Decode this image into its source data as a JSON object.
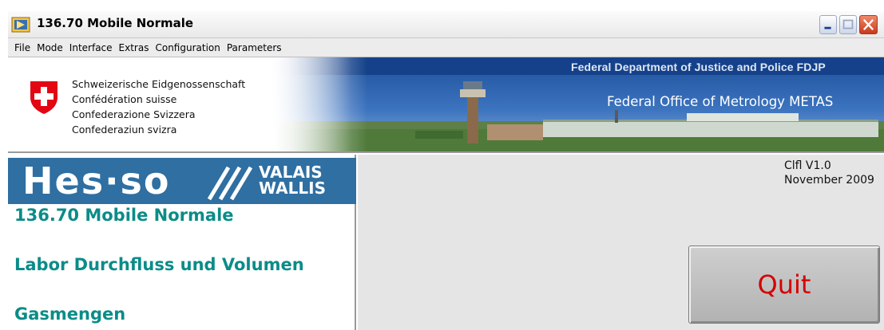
{
  "window": {
    "title": "136.70 Mobile Normale"
  },
  "menu": [
    "File",
    "Mode",
    "Interface",
    "Extras",
    "Configuration",
    "Parameters"
  ],
  "banner": {
    "confederation_lines": [
      "Schweizerische Eidgenossenschaft",
      "Confédération suisse",
      "Confederazione Svizzera",
      "Confederaziun svizra"
    ],
    "department": "Federal Department of Justice and Police FDJP",
    "office": "Federal Office of Metrology METAS"
  },
  "logo": {
    "name": "Hes·so",
    "region_line1": "VALAIS",
    "region_line2": "WALLIS"
  },
  "left_panel": {
    "line1": "136.70 Mobile Normale",
    "line2": "Labor Durchfluss und Volumen",
    "line3": "Gasmengen"
  },
  "right_panel": {
    "version": "Clfl  V1.0",
    "date": "November 2009",
    "quit_label": "Quit"
  },
  "colors": {
    "accent_teal": "#0b8c88",
    "hes_blue": "#2f6fa2",
    "quit_text": "#d40000",
    "swiss_red": "#e30613"
  },
  "icons": [
    "app-icon",
    "minimize-icon",
    "maximize-icon",
    "close-icon",
    "swiss-cross-icon"
  ]
}
